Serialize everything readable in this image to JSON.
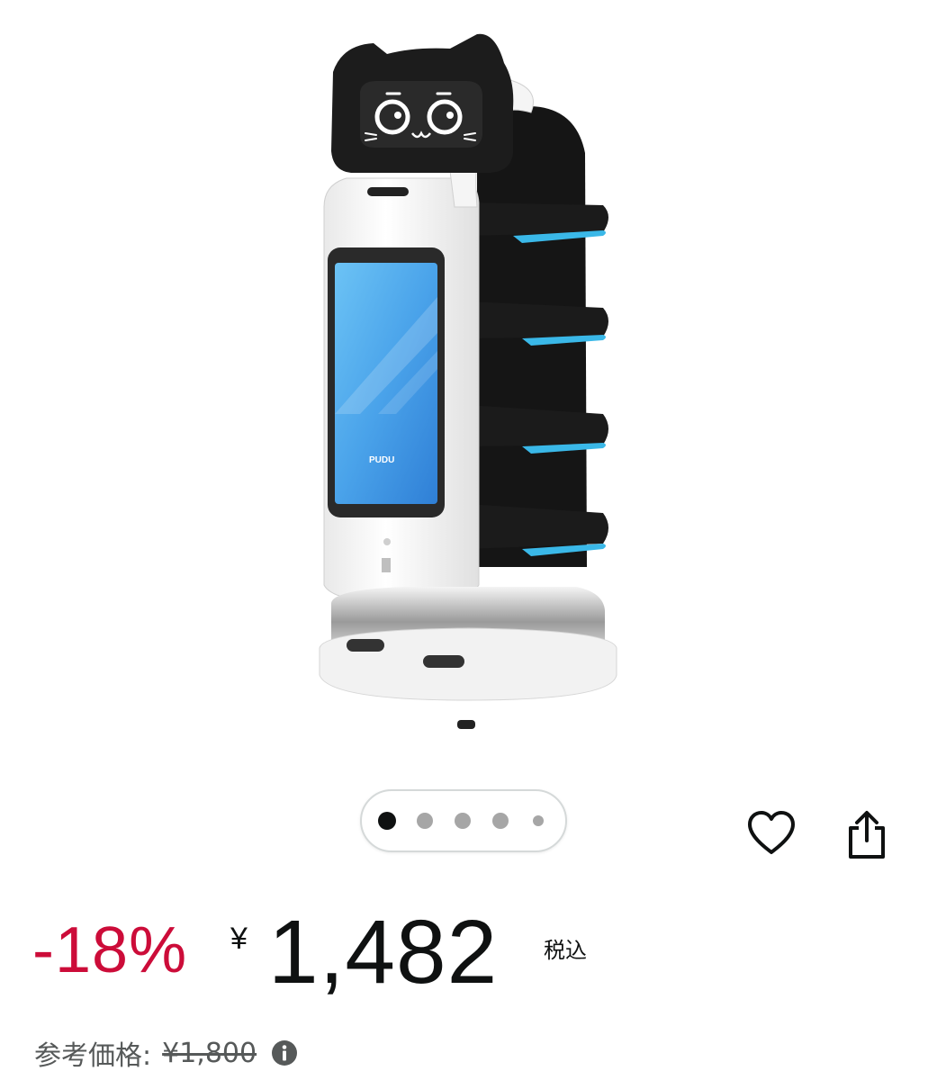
{
  "product": {
    "image_alt": "PUDU serving robot with cat face",
    "screen_brand": "PUDU"
  },
  "carousel": {
    "dot_count": 5,
    "active_index": 0
  },
  "actions": {
    "favorite_icon": "heart-icon",
    "share_icon": "share-icon"
  },
  "pricing": {
    "discount": "-18%",
    "currency_symbol": "¥",
    "price": "1,482",
    "tax_note": "税込",
    "reference_label": "参考価格:",
    "reference_price": "¥1,800",
    "info_icon": "info-icon"
  },
  "colors": {
    "discount_red": "#cc0c39",
    "text_dark": "#0f1111",
    "text_muted": "#565959",
    "screen_blue": "#5aaef0",
    "accent_cyan": "#3ab8e8"
  }
}
